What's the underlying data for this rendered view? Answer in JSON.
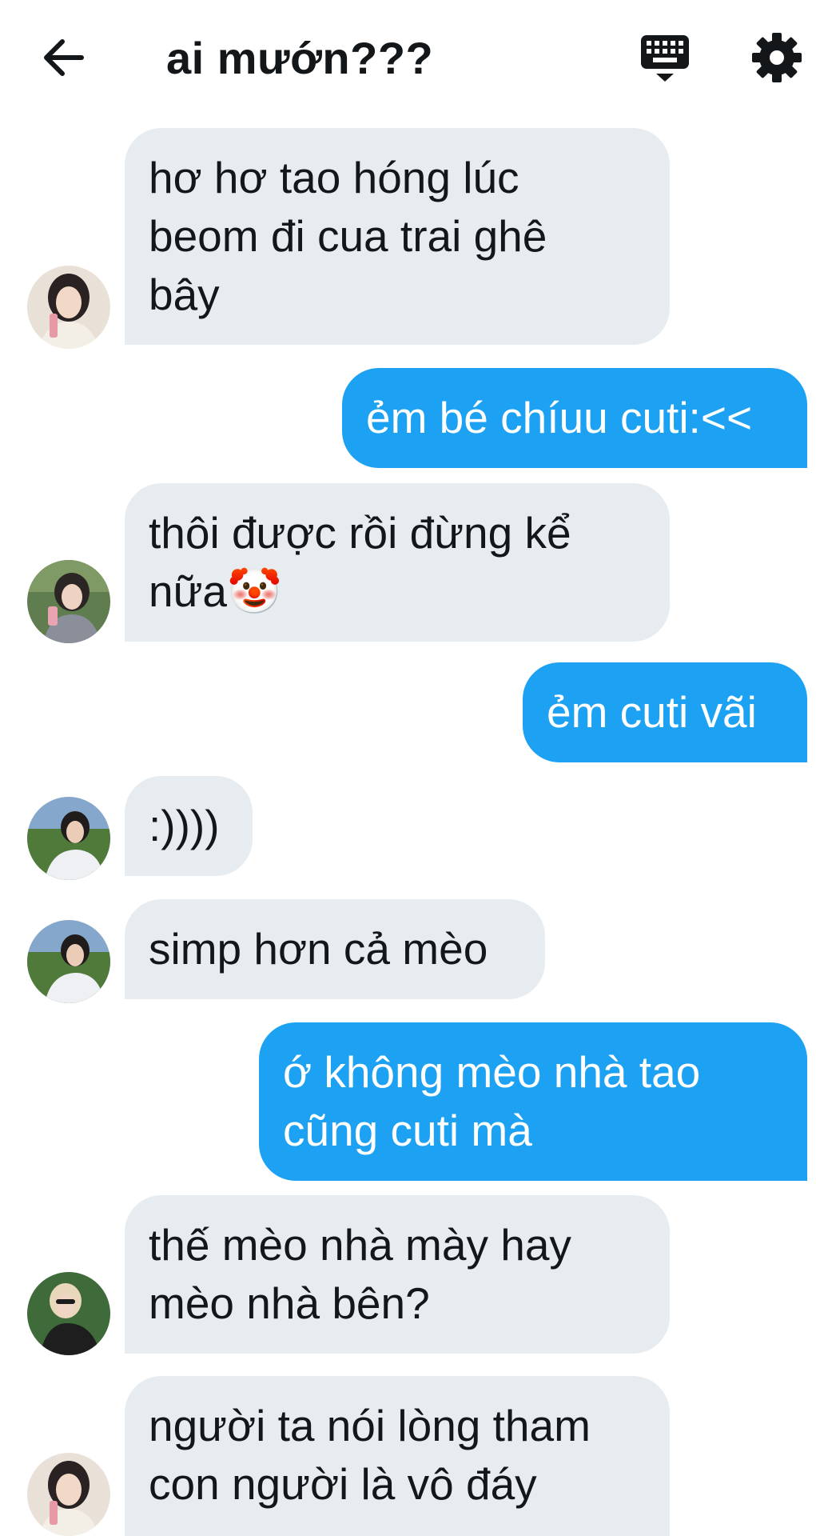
{
  "header": {
    "title": "ai mướn???"
  },
  "icons": {
    "back": "arrow-left-icon",
    "keyboard": "keyboard-icon",
    "settings": "gear-icon"
  },
  "colors": {
    "outgoing_bubble": "#1da1f2",
    "incoming_bubble": "#e6ecf0"
  },
  "messages": [
    {
      "direction": "incoming",
      "lines": [
        "hơ hơ tao hóng lúc",
        "beom đi cua trai ghê",
        "bây"
      ]
    },
    {
      "direction": "outgoing",
      "lines": [
        "ẻm bé chíuu cuti:<<"
      ]
    },
    {
      "direction": "incoming",
      "lines": [
        "thôi được rồi đừng kể",
        "nữa🤡"
      ]
    },
    {
      "direction": "outgoing",
      "lines": [
        "ẻm cuti vãi"
      ]
    },
    {
      "direction": "incoming",
      "lines": [
        ":))))"
      ]
    },
    {
      "direction": "incoming",
      "lines": [
        "simp hơn cả mèo"
      ]
    },
    {
      "direction": "outgoing",
      "lines": [
        "ớ không mèo nhà tao",
        "cũng cuti mà"
      ]
    },
    {
      "direction": "incoming",
      "lines": [
        "thế mèo nhà mày hay",
        "mèo nhà bên?"
      ]
    },
    {
      "direction": "incoming",
      "lines": [
        "người ta nói lòng tham",
        "con người là vô đáy"
      ]
    }
  ]
}
